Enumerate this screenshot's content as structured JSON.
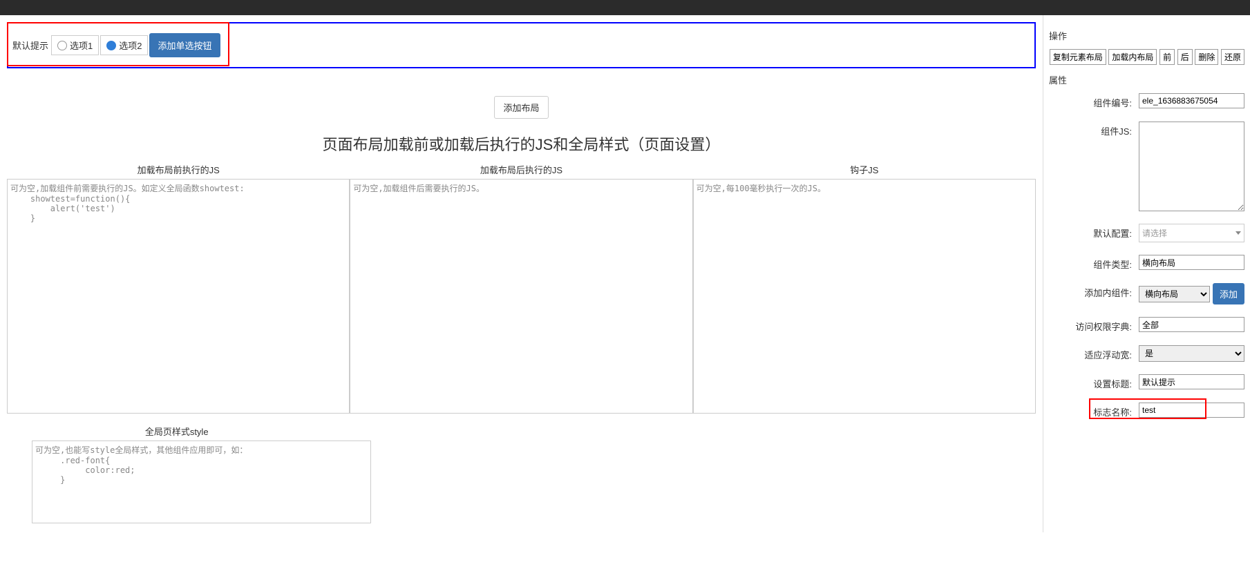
{
  "topRadio": {
    "promptLabel": "默认提示",
    "option1": "选项1",
    "option2": "选项2",
    "addRadioBtn": "添加单选按钮"
  },
  "addLayoutBtn": "添加布局",
  "pageSettingsTitle": "页面布局加载前或加载后执行的JS和全局样式（页面设置）",
  "jsCols": {
    "before": {
      "header": "加载布局前执行的JS",
      "placeholder": "可为空,加载组件前需要执行的JS。如定义全局函数showtest:\n    showtest=function(){\n        alert('test')\n    }"
    },
    "after": {
      "header": "加载布局后执行的JS",
      "placeholder": "可为空,加载组件后需要执行的JS。"
    },
    "hook": {
      "header": "钩子JS",
      "placeholder": "可为空,每100毫秒执行一次的JS。"
    }
  },
  "globalStyle": {
    "header": "全局页样式style",
    "placeholder": "可为空,也能写style全局样式，其他组件应用即可，如：\n     .red-font{\n          color:red;\n     }"
  },
  "rightPanel": {
    "opsTitle": "操作",
    "actions": {
      "copyLayout": "复制元素布局",
      "loadInner": "加载内布局",
      "front": "前",
      "back": "后",
      "delete": "删除",
      "restore": "还原"
    },
    "propsTitle": "属性",
    "fields": {
      "componentIdLabel": "组件编号:",
      "componentIdValue": "ele_1636883675054",
      "componentJsLabel": "组件JS:",
      "componentJsValue": "",
      "defaultConfigLabel": "默认配置:",
      "defaultConfigPlaceholder": "请选择",
      "componentTypeLabel": "组件类型:",
      "componentTypeValue": "横向布局",
      "addInnerLabel": "添加内组件:",
      "addInnerSelectValue": "横向布局",
      "addInnerBtn": "添加",
      "permDictLabel": "访问权限字典:",
      "permDictValue": "全部",
      "floatWidthLabel": "适应浮动宽:",
      "floatWidthValue": "是",
      "setTitleLabel": "设置标题:",
      "setTitleValue": "默认提示",
      "flagNameLabel": "标志名称:",
      "flagNameValue": "test"
    }
  }
}
